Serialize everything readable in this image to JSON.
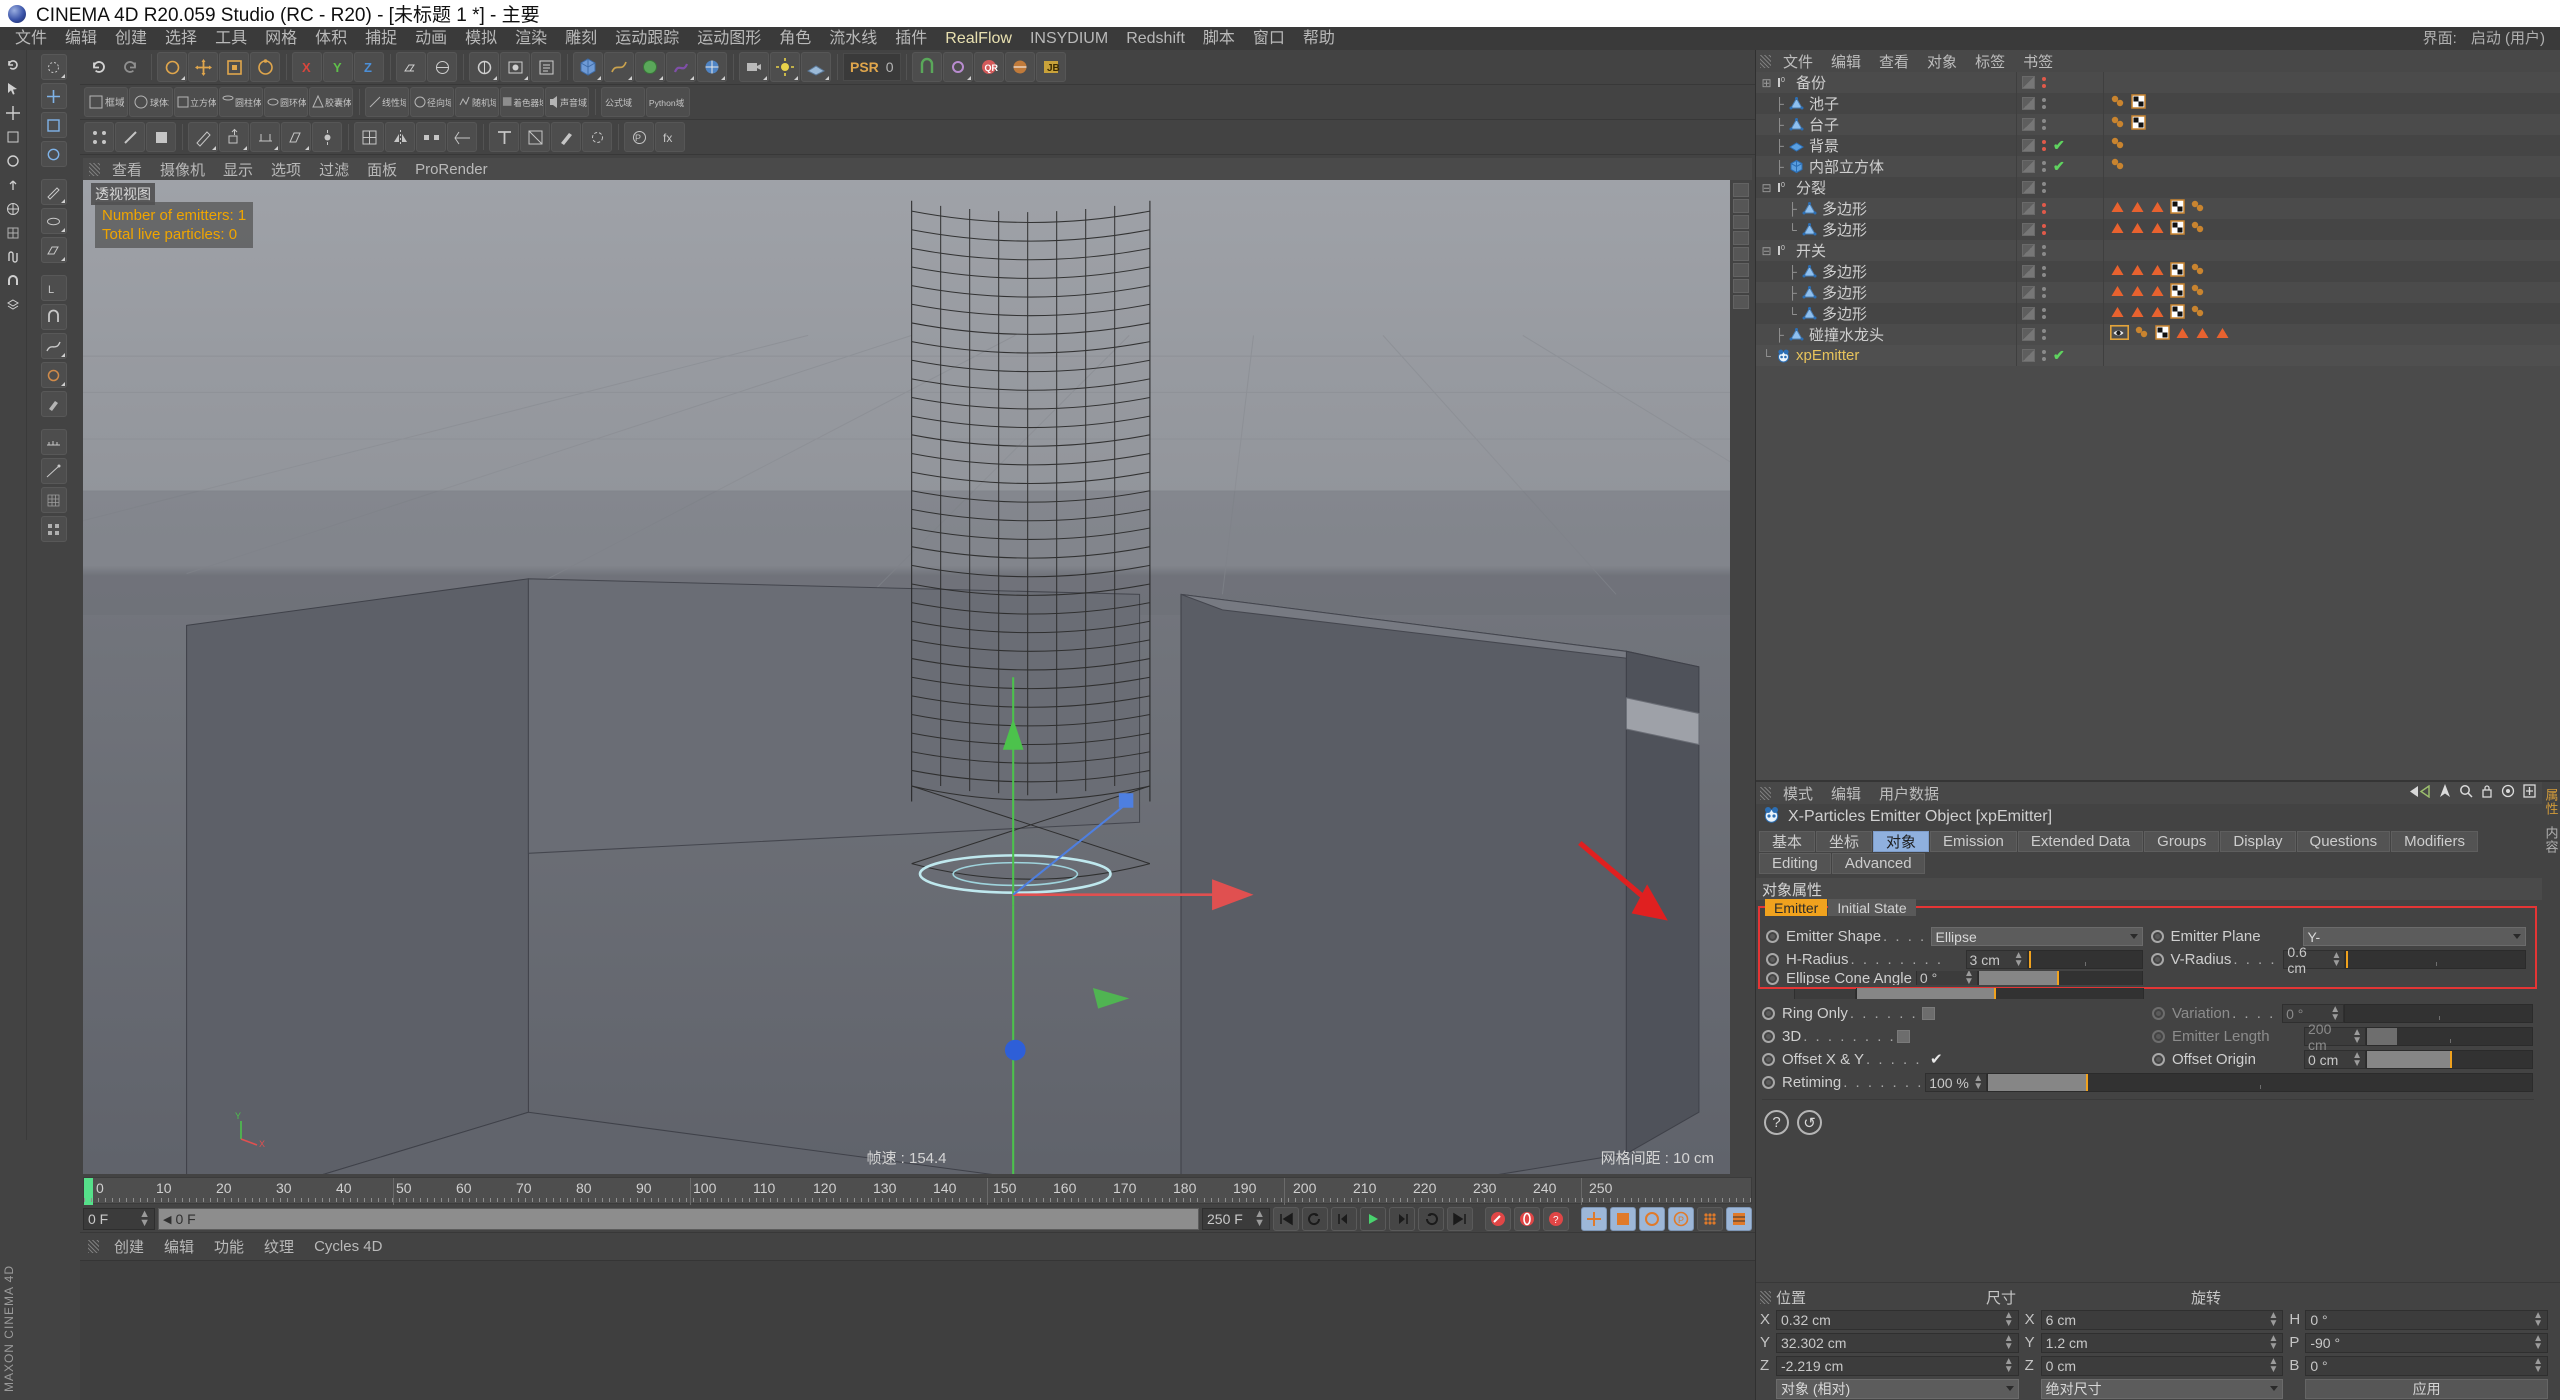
{
  "titlebar": {
    "title": "CINEMA 4D R20.059 Studio (RC - R20) - [未标题 1 *] - 主要"
  },
  "menubar": {
    "items": [
      "文件",
      "编辑",
      "创建",
      "选择",
      "工具",
      "网格",
      "体积",
      "捕捉",
      "动画",
      "模拟",
      "渲染",
      "雕刻",
      "运动跟踪",
      "运动图形",
      "角色",
      "流水线",
      "插件"
    ],
    "accent_items": [
      "RealFlow"
    ],
    "after_accent": [
      "INSYDIUM",
      "Redshift",
      "脚本",
      "窗口",
      "帮助"
    ],
    "right_items": [
      "界面:",
      "启动 (用户)"
    ]
  },
  "toolbar": {
    "psr_label": "PSR",
    "psr_value": "0",
    "qr_label": "QR"
  },
  "viewport": {
    "menu": [
      "查看",
      "摄像机",
      "显示",
      "选项",
      "过滤",
      "面板",
      "ProRender"
    ],
    "label": "透视视图",
    "hud": [
      "Number of emitters: 1",
      "Total live particles: 0"
    ],
    "fps": "帧速 : 154.4",
    "grid": "网格间距 : 10 cm",
    "axis_x": "X",
    "axis_y": "Y"
  },
  "timeline": {
    "ticks": [
      "0",
      "10",
      "20",
      "30",
      "40",
      "50",
      "60",
      "70",
      "80",
      "90",
      "100",
      "110",
      "120",
      "130",
      "140",
      "150",
      "160",
      "170",
      "180",
      "190",
      "200",
      "210",
      "220",
      "230",
      "240",
      "250"
    ],
    "current_frame": "0 F",
    "current_frame_bar": "0 F",
    "end_frame": "250 F",
    "preview_end": "250 F",
    "right_frame": "0 F"
  },
  "statusbar": {
    "items": [
      "创建",
      "编辑",
      "功能",
      "纹理",
      "Cycles 4D"
    ]
  },
  "object_manager": {
    "menu": [
      "文件",
      "编辑",
      "查看",
      "对象",
      "标签",
      "书签"
    ],
    "rows": [
      {
        "label": "备份",
        "indent": 0,
        "icon": "null-icon",
        "tree": "+",
        "dots": "red",
        "check": false,
        "tags": []
      },
      {
        "label": "池子",
        "indent": 1,
        "icon": "polygon-icon",
        "tree": "├",
        "dots": "grey",
        "check": false,
        "tags": [
          "spheres",
          "checker"
        ]
      },
      {
        "label": "台子",
        "indent": 1,
        "icon": "polygon-icon",
        "tree": "├",
        "dots": "grey",
        "check": false,
        "tags": [
          "spheres",
          "checker"
        ]
      },
      {
        "label": "背景",
        "indent": 1,
        "icon": "plane-icon",
        "tree": "├",
        "dots": "red",
        "check": true,
        "tags": [
          "spheres"
        ]
      },
      {
        "label": "内部立方体",
        "indent": 1,
        "icon": "cube-icon",
        "tree": "├",
        "dots": "grey",
        "check": true,
        "tags": [
          "spheres"
        ]
      },
      {
        "label": "分裂",
        "indent": 0,
        "icon": "null-icon",
        "tree": "-",
        "dots": "grey",
        "check": false,
        "tags": []
      },
      {
        "label": "多边形",
        "indent": 2,
        "icon": "polygon-icon",
        "tree": "├",
        "dots": "red",
        "check": false,
        "tags": [
          "tri",
          "tri",
          "tri",
          "checker",
          "spheres"
        ]
      },
      {
        "label": "多边形",
        "indent": 2,
        "icon": "polygon-icon",
        "tree": "└",
        "dots": "red",
        "check": false,
        "tags": [
          "tri",
          "tri",
          "tri",
          "checker",
          "spheres"
        ]
      },
      {
        "label": "开关",
        "indent": 0,
        "icon": "null-icon",
        "tree": "-",
        "dots": "grey",
        "check": false,
        "tags": []
      },
      {
        "label": "多边形",
        "indent": 2,
        "icon": "polygon-icon",
        "tree": "├",
        "dots": "grey",
        "check": false,
        "tags": [
          "tri",
          "tri",
          "tri",
          "checker",
          "spheres"
        ]
      },
      {
        "label": "多边形",
        "indent": 2,
        "icon": "polygon-icon",
        "tree": "├",
        "dots": "grey",
        "check": false,
        "tags": [
          "tri",
          "tri",
          "tri",
          "checker",
          "spheres"
        ]
      },
      {
        "label": "多边形",
        "indent": 2,
        "icon": "polygon-icon",
        "tree": "└",
        "dots": "grey",
        "check": false,
        "tags": [
          "tri",
          "tri",
          "tri",
          "checker",
          "spheres"
        ]
      },
      {
        "label": "碰撞水龙头",
        "indent": 1,
        "icon": "polygon-icon",
        "tree": "├",
        "dots": "grey",
        "check": false,
        "tags": [
          "eye",
          "spheres",
          "checker",
          "tri",
          "tri",
          "tri"
        ]
      },
      {
        "label": "xpEmitter",
        "indent": 0,
        "icon": "xp-icon",
        "tree": "└",
        "dots": "grey",
        "check": true,
        "tags": [],
        "highlight": true
      }
    ]
  },
  "attribute_manager": {
    "menu": [
      "模式",
      "编辑",
      "用户数据"
    ],
    "object_title": "X-Particles Emitter Object [xpEmitter]",
    "tabs": [
      {
        "label": "基本",
        "active": false
      },
      {
        "label": "坐标",
        "active": false
      },
      {
        "label": "对象",
        "active": true
      },
      {
        "label": "Emission",
        "active": false
      },
      {
        "label": "Extended Data",
        "active": false
      },
      {
        "label": "Groups",
        "active": false
      },
      {
        "label": "Display",
        "active": false
      },
      {
        "label": "Questions",
        "active": false
      },
      {
        "label": "Modifiers",
        "active": false
      },
      {
        "label": "Editing",
        "active": false
      },
      {
        "label": "Advanced",
        "active": false
      }
    ],
    "section_title": "对象属性",
    "subtabs": [
      {
        "label": "Emitter",
        "active": true
      },
      {
        "label": "Initial State",
        "active": false
      }
    ],
    "fields": {
      "emitter_shape": {
        "label": "Emitter Shape",
        "dots": ". . . .",
        "value": "Ellipse"
      },
      "emitter_plane": {
        "label": "Emitter Plane",
        "value": "Y-"
      },
      "h_radius": {
        "label": "H-Radius",
        "dots": ". . . . . . . .",
        "value": "3 cm"
      },
      "v_radius": {
        "label": "V-Radius",
        "dots": ". . . . .",
        "value": "0.6 cm"
      },
      "ellipse_cone": {
        "label": "Ellipse Cone Angle",
        "value": "0 °"
      },
      "ring_only": {
        "label": "Ring Only",
        "dots": ". . . . . . .",
        "value": ""
      },
      "variation": {
        "label": "Variation",
        "dots": ". . . . .",
        "value": "0 °"
      },
      "three_d": {
        "label": "3D",
        "dots": ". . . . . . . . . . . .",
        "value": ""
      },
      "emitter_length": {
        "label": "Emitter Length",
        "value": "200 cm"
      },
      "offset_xy": {
        "label": "Offset X & Y",
        "dots": ". . . . . .",
        "value": "✔"
      },
      "offset_origin": {
        "label": "Offset Origin",
        "value": "0 cm"
      },
      "retiming": {
        "label": "Retiming",
        "dots": ". . . . . . . . .",
        "value": "100 %"
      }
    }
  },
  "coordinates": {
    "headers": [
      "位置",
      "尺寸",
      "旋转"
    ],
    "rows": [
      {
        "ax1": "X",
        "v1": "0.32 cm",
        "ax2": "X",
        "v2": "6 cm",
        "ax3": "H",
        "v3": "0 °"
      },
      {
        "ax1": "Y",
        "v1": "32.302 cm",
        "ax2": "Y",
        "v2": "1.2 cm",
        "ax3": "P",
        "v3": "-90 °"
      },
      {
        "ax1": "Z",
        "v1": "-2.219 cm",
        "ax2": "Z",
        "v2": "0 cm",
        "ax3": "B",
        "v3": "0 °"
      }
    ],
    "mode_select": "对象 (相对)",
    "size_select": "绝对尺寸",
    "apply_button": "应用"
  },
  "right_strip": {
    "vertical_labels": [
      "属性",
      "内容"
    ]
  },
  "watermark": {
    "text": "MAXON CINEMA 4D"
  }
}
